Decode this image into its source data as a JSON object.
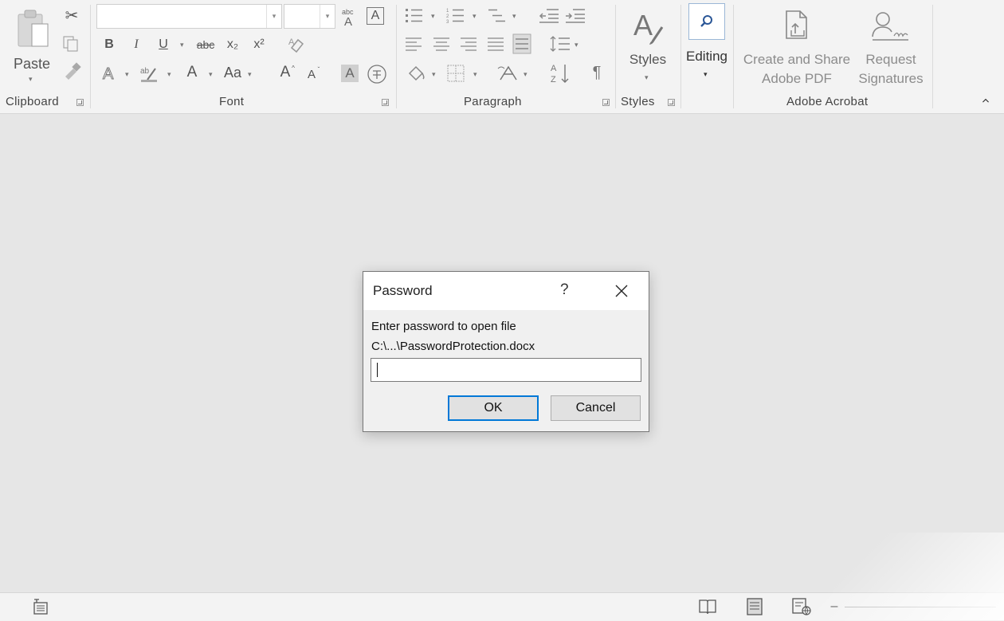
{
  "ribbon": {
    "groups": {
      "clipboard": "Clipboard",
      "font": "Font",
      "paragraph": "Paragraph",
      "styles": "Styles",
      "adobe": "Adobe Acrobat"
    },
    "clipboard": {
      "paste": "Paste"
    },
    "font": {
      "bold": "B",
      "italic": "I",
      "underline": "U",
      "strike": "abc",
      "subscript": "x₂",
      "superscript": "x²",
      "font_color": "A",
      "change_case": "Aa",
      "grow": "A",
      "shrink": "A",
      "text_effects": "A"
    },
    "styles": {
      "label": "Styles"
    },
    "editing": {
      "label": "Editing"
    },
    "adobe": {
      "create_share_line1": "Create and Share",
      "create_share_line2": "Adobe PDF",
      "request_line1": "Request",
      "request_line2": "Signatures"
    }
  },
  "dialog": {
    "title": "Password",
    "help": "?",
    "message": "Enter password to open file",
    "path": "C:\\...\\PasswordProtection.docx",
    "password_value": "",
    "ok": "OK",
    "cancel": "Cancel"
  },
  "status": {
    "zoom_minus": "–"
  },
  "colors": {
    "accent": "#0078d7",
    "ribbon_bg": "#f3f3f3",
    "workspace_bg": "#e6e6e6"
  }
}
